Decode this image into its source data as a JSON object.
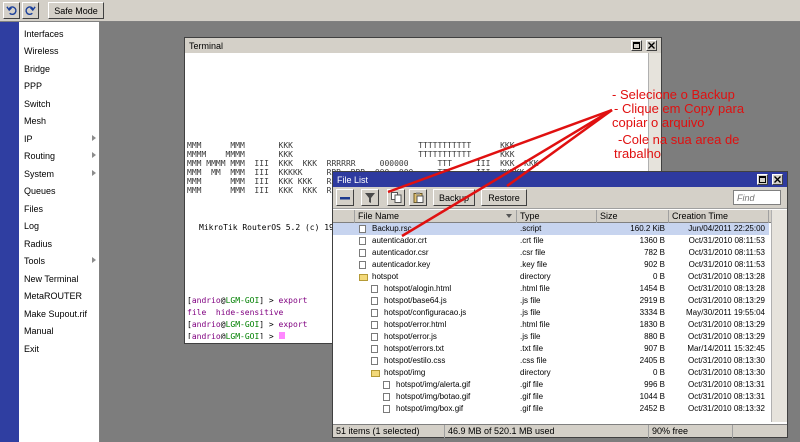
{
  "toolbar": {
    "undo_icon": "undo-icon",
    "redo_icon": "redo-icon",
    "safe_mode_label": "Safe Mode"
  },
  "sidebar": {
    "items": [
      {
        "label": "Interfaces",
        "submenu": false
      },
      {
        "label": "Wireless",
        "submenu": false
      },
      {
        "label": "Bridge",
        "submenu": false
      },
      {
        "label": "PPP",
        "submenu": false
      },
      {
        "label": "Switch",
        "submenu": false
      },
      {
        "label": "Mesh",
        "submenu": false
      },
      {
        "label": "IP",
        "submenu": true
      },
      {
        "label": "Routing",
        "submenu": true
      },
      {
        "label": "System",
        "submenu": true
      },
      {
        "label": "Queues",
        "submenu": false
      },
      {
        "label": "Files",
        "submenu": false
      },
      {
        "label": "Log",
        "submenu": false
      },
      {
        "label": "Radius",
        "submenu": false
      },
      {
        "label": "Tools",
        "submenu": true
      },
      {
        "label": "New Terminal",
        "submenu": false
      },
      {
        "label": "MetaROUTER",
        "submenu": false
      },
      {
        "label": "Make Supout.rif",
        "submenu": false
      },
      {
        "label": "Manual",
        "submenu": false
      },
      {
        "label": "Exit",
        "submenu": false
      }
    ]
  },
  "terminal": {
    "title": "Terminal",
    "banner": [
      "MMM      MMM       KKK                          TTTTTTTTTTT      KKK",
      "MMMM    MMMM       KKK                          TTTTTTTTTTT      KKK",
      "MMM MMMM MMM  III  KKK  KKK  RRRRRR     000000      TTT     III  KKK  KKK",
      "MMM  MM  MMM  III  KKKKK     RRR  RRR  000  000     TTT     III  KKKKK",
      "MMM      MMM  III  KKK KKK   RRRRRR    000  000     TTT     III  KKK KKK",
      "MMM      MMM  III  KKK  KKK  RRR  RRR   000000      TTT     III  KKK  KKK"
    ],
    "version_line": "MikroTik RouterOS 5.2 (c) 1999-2011       http://www.mikrotik.com/",
    "prompt_user": "andrio",
    "prompt_host": "LGM-GOI",
    "prompt_prefix": "[",
    "prompt_suffix": "] > ",
    "cmd_export": "export",
    "hide_line": "file  hide-sensitive"
  },
  "file_list": {
    "title": "File List",
    "backup_label": "Backup",
    "restore_label": "Restore",
    "find_placeholder": "Find",
    "columns": {
      "name": "File Name",
      "type": "Type",
      "size": "Size",
      "created": "Creation Time"
    },
    "rows": [
      {
        "name": "Backup.rsc",
        "type": ".script",
        "size": "160.2 KiB",
        "created": "Jun/04/2011 22:25:00",
        "icon": "file-icon",
        "indent": 0,
        "selected": true
      },
      {
        "name": "autenticador.crt",
        "type": ".crt file",
        "size": "1360 B",
        "created": "Oct/31/2010 08:11:53",
        "icon": "file-icon",
        "indent": 0,
        "selected": false
      },
      {
        "name": "autenticador.csr",
        "type": ".csr file",
        "size": "782 B",
        "created": "Oct/31/2010 08:11:53",
        "icon": "file-icon",
        "indent": 0,
        "selected": false
      },
      {
        "name": "autenticador.key",
        "type": ".key file",
        "size": "902 B",
        "created": "Oct/31/2010 08:11:53",
        "icon": "file-icon",
        "indent": 0,
        "selected": false
      },
      {
        "name": "hotspot",
        "type": "directory",
        "size": "0 B",
        "created": "Oct/31/2010 08:13:28",
        "icon": "folder-icon",
        "indent": 0,
        "selected": false
      },
      {
        "name": "hotspot/alogin.html",
        "type": ".html file",
        "size": "1454 B",
        "created": "Oct/31/2010 08:13:28",
        "icon": "file-icon",
        "indent": 1,
        "selected": false
      },
      {
        "name": "hotspot/base64.js",
        "type": ".js file",
        "size": "2919 B",
        "created": "Oct/31/2010 08:13:29",
        "icon": "file-icon",
        "indent": 1,
        "selected": false
      },
      {
        "name": "hotspot/configuracao.js",
        "type": ".js file",
        "size": "3334 B",
        "created": "May/30/2011 19:55:04",
        "icon": "file-icon",
        "indent": 1,
        "selected": false
      },
      {
        "name": "hotspot/error.html",
        "type": ".html file",
        "size": "1830 B",
        "created": "Oct/31/2010 08:13:29",
        "icon": "file-icon",
        "indent": 1,
        "selected": false
      },
      {
        "name": "hotspot/error.js",
        "type": ".js file",
        "size": "880 B",
        "created": "Oct/31/2010 08:13:29",
        "icon": "file-icon",
        "indent": 1,
        "selected": false
      },
      {
        "name": "hotspot/errors.txt",
        "type": ".txt file",
        "size": "907 B",
        "created": "Mar/14/2011 15:32:45",
        "icon": "file-icon",
        "indent": 1,
        "selected": false
      },
      {
        "name": "hotspot/estilo.css",
        "type": ".css file",
        "size": "2405 B",
        "created": "Oct/31/2010 08:13:30",
        "icon": "file-icon",
        "indent": 1,
        "selected": false
      },
      {
        "name": "hotspot/img",
        "type": "directory",
        "size": "0 B",
        "created": "Oct/31/2010 08:13:30",
        "icon": "folder-icon",
        "indent": 1,
        "selected": false
      },
      {
        "name": "hotspot/img/alerta.gif",
        "type": ".gif file",
        "size": "996 B",
        "created": "Oct/31/2010 08:13:31",
        "icon": "file-icon",
        "indent": 2,
        "selected": false
      },
      {
        "name": "hotspot/img/botao.gif",
        "type": ".gif file",
        "size": "1044 B",
        "created": "Oct/31/2010 08:13:31",
        "icon": "file-icon",
        "indent": 2,
        "selected": false
      },
      {
        "name": "hotspot/img/box.gif",
        "type": ".gif file",
        "size": "2452 B",
        "created": "Oct/31/2010 08:13:32",
        "icon": "file-icon",
        "indent": 2,
        "selected": false
      }
    ],
    "status": {
      "items": "51 items (1 selected)",
      "disk": "46.9 MB of 520.1 MB used",
      "free": "90% free"
    }
  },
  "annotations": {
    "line1": "- Selecione o Backup",
    "line2": "- Clique em Copy para",
    "line3": "copiar o arquivo",
    "line4": "-Cole na sua area de",
    "line5": "trabalho",
    "color": "#e01010"
  },
  "colors": {
    "title_active": "#2e3a9f",
    "sidebar_bar": "#2f3ea1",
    "selection": "#c7d4ef",
    "prompt_user": "#800080",
    "prompt_host": "#008000"
  }
}
